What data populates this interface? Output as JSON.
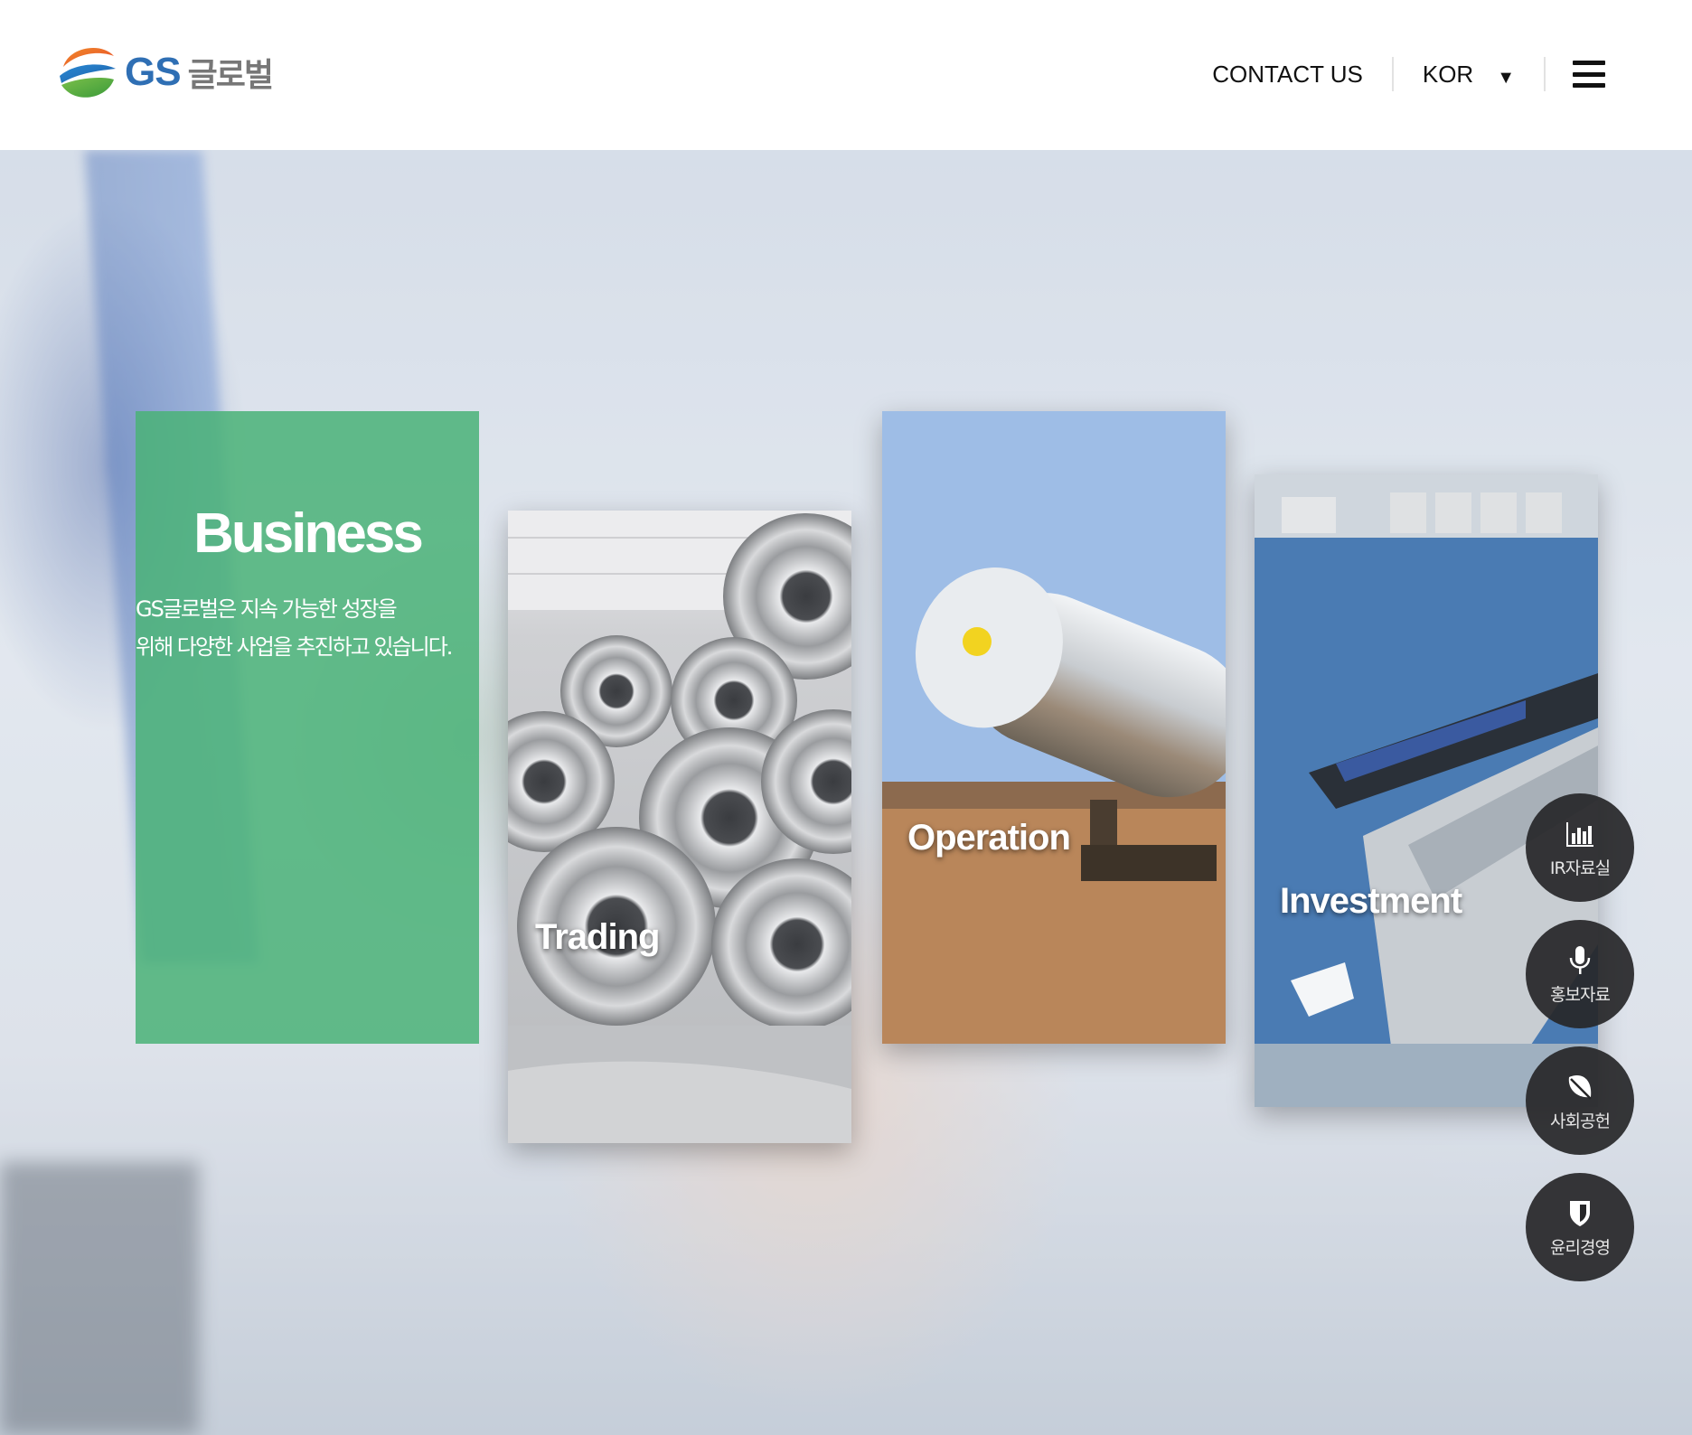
{
  "header": {
    "logo_text": "GS",
    "logo_korean": "글로벌",
    "contact_label": "CONTACT US",
    "language": "KOR"
  },
  "hero": {
    "business": {
      "title": "Business",
      "description_line1": "GS글로벌은 지속 가능한 성장을",
      "description_line2": "위해 다양한 사업을 추진하고 있습니다."
    },
    "panels": [
      {
        "title": "Trading"
      },
      {
        "title": "Operation"
      },
      {
        "title": "Investment"
      }
    ]
  },
  "quick_menu": [
    {
      "label": "IR자료실",
      "icon": "bar-chart-icon"
    },
    {
      "label": "홍보자료",
      "icon": "microphone-icon"
    },
    {
      "label": "사회공헌",
      "icon": "leaf-icon"
    },
    {
      "label": "윤리경영",
      "icon": "shield-icon"
    }
  ],
  "colors": {
    "business_green": "#4ab278",
    "logo_blue": "#2f6fb4",
    "fab_bg": "#262628"
  }
}
